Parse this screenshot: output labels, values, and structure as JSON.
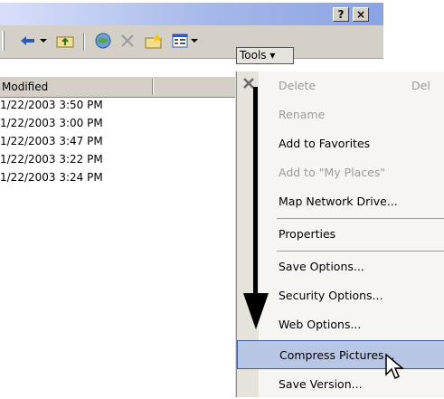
{
  "titlebar": {
    "help_label": "?",
    "close_label": "×"
  },
  "toolbar": {
    "tools_label": "Tools ▾",
    "icons": [
      "back-icon",
      "dropdown-arrow-icon",
      "up-folder-icon",
      "search-web-icon",
      "delete-icon",
      "new-folder-icon",
      "views-icon",
      "dropdown-arrow-icon"
    ]
  },
  "columns": {
    "modified": "Modified"
  },
  "rows": [
    "1/22/2003 3:50 PM",
    "1/22/2003 3:00 PM",
    "1/22/2003 3:47 PM",
    "1/22/2003 3:22 PM",
    "1/22/2003 3:24 PM"
  ],
  "menu": {
    "items": [
      {
        "label": "Delete",
        "accel": "Del",
        "disabled": true
      },
      {
        "label": "Rename",
        "accel": "",
        "disabled": true
      },
      {
        "label": "Add to Favorites",
        "accel": "",
        "disabled": false
      },
      {
        "label": "Add to \"My Places\"",
        "accel": "",
        "disabled": true
      },
      {
        "label": "Map Network Drive...",
        "accel": "",
        "disabled": false
      },
      {
        "label": "Properties",
        "accel": "",
        "disabled": false
      },
      {
        "label": "Save Options...",
        "accel": "",
        "disabled": false
      },
      {
        "label": "Security Options...",
        "accel": "",
        "disabled": false
      },
      {
        "label": "Web Options...",
        "accel": "",
        "disabled": false
      },
      {
        "label": "Compress Pictures...",
        "accel": "",
        "disabled": false,
        "highlighted": true
      },
      {
        "label": "Save Version...",
        "accel": "",
        "disabled": false
      }
    ]
  },
  "colors": {
    "highlight": "#b8c6e6",
    "titlebar": "#a5b8ea"
  }
}
